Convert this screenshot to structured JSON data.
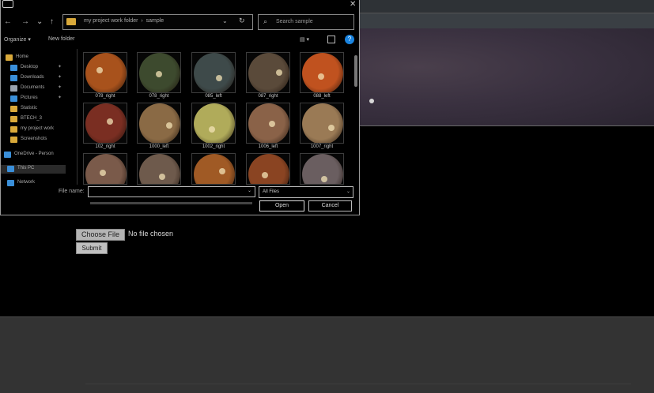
{
  "dialog": {
    "address": {
      "path": [
        "my project work folder",
        "sample"
      ]
    },
    "search_placeholder": "Search sample",
    "toolbar": {
      "organize": "Organize ▾",
      "new_folder": "New folder"
    },
    "sidebar": [
      {
        "label": "Home",
        "icon": "home-icon",
        "color": "#d9a93a",
        "pinned": false
      },
      {
        "label": "Desktop",
        "icon": "desktop-icon",
        "color": "#3a8fd9",
        "pinned": true
      },
      {
        "label": "Downloads",
        "icon": "download-icon",
        "color": "#3a8fd9",
        "pinned": true
      },
      {
        "label": "Documents",
        "icon": "documents-icon",
        "color": "#9aa4b0",
        "pinned": true
      },
      {
        "label": "Pictures",
        "icon": "pictures-icon",
        "color": "#3a8fd9",
        "pinned": true
      },
      {
        "label": "Statistic",
        "icon": "folder-icon",
        "color": "#d9a93a",
        "pinned": false
      },
      {
        "label": "BTECH_3",
        "icon": "folder-icon",
        "color": "#d9a93a",
        "pinned": false
      },
      {
        "label": "my project work",
        "icon": "folder-icon",
        "color": "#d9a93a",
        "pinned": false
      },
      {
        "label": "Screenshots",
        "icon": "folder-icon",
        "color": "#d9a93a",
        "pinned": false
      },
      {
        "label": "OneDrive - Person",
        "icon": "cloud-icon",
        "color": "#3a8fd9",
        "pinned": false
      },
      {
        "label": "This PC",
        "icon": "computer-icon",
        "color": "#3a8fd9",
        "pinned": false,
        "selected": true
      },
      {
        "label": "Network",
        "icon": "network-icon",
        "color": "#3a8fd9",
        "pinned": false
      }
    ],
    "files": [
      {
        "name": "078_right",
        "color": "#a8521c"
      },
      {
        "name": "078_right",
        "color": "#3d4a2e"
      },
      {
        "name": "085_left",
        "color": "#3e4a4a"
      },
      {
        "name": "087_right",
        "color": "#5a4a3a"
      },
      {
        "name": "088_left",
        "color": "#c0521f"
      },
      {
        "name": "102_right",
        "color": "#7a2e22"
      },
      {
        "name": "1000_left",
        "color": "#8a6a45"
      },
      {
        "name": "1002_right",
        "color": "#b0ab5a"
      },
      {
        "name": "1006_left",
        "color": "#8a6248"
      },
      {
        "name": "1007_right",
        "color": "#9a7a55"
      },
      {
        "name": "",
        "color": "#7a5a4a"
      },
      {
        "name": "",
        "color": "#6e5a4c"
      },
      {
        "name": "",
        "color": "#a05a25"
      },
      {
        "name": "",
        "color": "#8a4422"
      },
      {
        "name": "",
        "color": "#6a5e60"
      }
    ],
    "filename_label": "File name:",
    "filename_value": "",
    "filetype": "All Files",
    "open_label": "Open",
    "cancel_label": "Cancel"
  },
  "page": {
    "choose_file_label": "Choose File",
    "no_file_text": "No file chosen",
    "submit_label": "Submit"
  }
}
